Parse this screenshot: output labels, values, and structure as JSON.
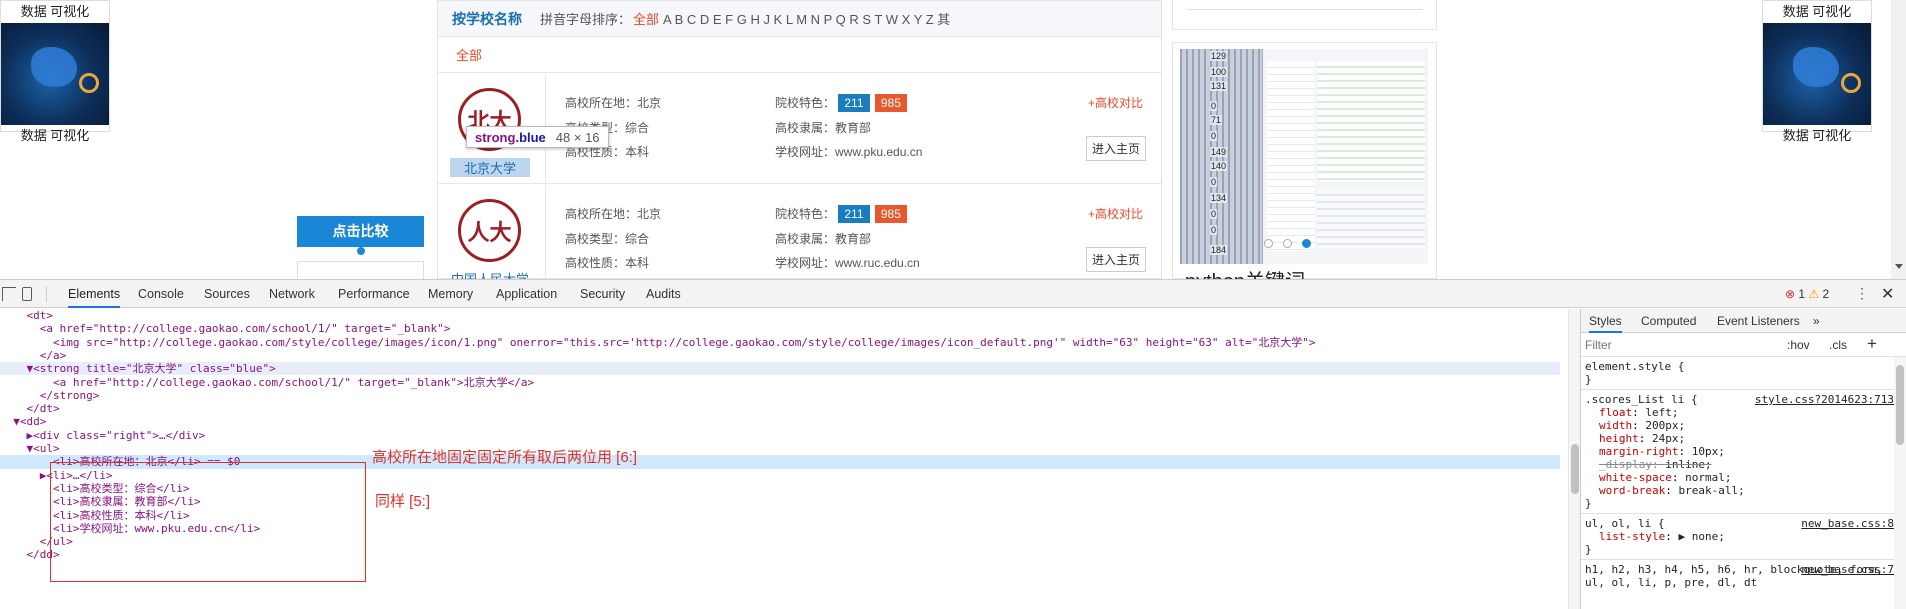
{
  "page": {
    "ads": [
      {
        "caption_top": "数据 可视化",
        "caption_bottom": "数据 可视化"
      },
      {
        "caption_top": "数据 可视化",
        "caption_bottom": "数据 可视化"
      }
    ],
    "sortbar": {
      "title": "按学校名称",
      "pinyin_label": "拼音字母排序：",
      "all": "全部",
      "letters": "A B C D E F G H J K L M N P Q R S T W X Y Z 其"
    },
    "all_row": "全部",
    "colleges": [
      {
        "logo": "北大",
        "name": "北京大学",
        "location": "高校所在地：北京",
        "type": "高校类型：综合",
        "nature": "高校性质：本科",
        "feature_label": "院校特色：",
        "tag1": "211",
        "tag2": "985",
        "affiliation": "高校隶属：教育部",
        "site": "学校网址：www.pku.edu.cn",
        "compare": "+高校对比",
        "home": "进入主页"
      },
      {
        "logo": "人大",
        "name": "中国人民大学",
        "location": "高校所在地：北京",
        "type": "高校类型：综合",
        "nature": "高校性质：本科",
        "feature_label": "院校特色：",
        "tag1": "211",
        "tag2": "985",
        "affiliation": "高校隶属：教育部",
        "site": "学校网址：www.ruc.edu.cn",
        "compare": "+高校对比",
        "home": "进入主页"
      }
    ],
    "tooltip": {
      "tag": "strong",
      "cls": ".blue",
      "size": "48 × 16"
    },
    "compare_button": "点击比较",
    "side_ruler": [
      "129",
      "100",
      "131",
      "0",
      "71",
      "0",
      "149",
      "140",
      "0",
      "134",
      "0",
      "0",
      "184"
    ],
    "side_keyword": "python关键词"
  },
  "devtools": {
    "tabs": [
      "Elements",
      "Console",
      "Sources",
      "Network",
      "Performance",
      "Memory",
      "Application",
      "Security",
      "Audits"
    ],
    "active_tab": "Elements",
    "errors": "1",
    "warnings": "2",
    "dom_lines": [
      {
        "t": "    <dt>"
      },
      {
        "t": "      <a href=\"http://college.gaokao.com/school/1/\" target=\"_blank\">"
      },
      {
        "t": "        <img src=\"http://college.gaokao.com/style/college/images/icon/1.png\" onerror=\"this.src='http://college.gaokao.com/style/college/images/icon_default.png'\" width=\"63\" height=\"63\" alt=\"北京大学\">"
      },
      {
        "t": "      </a>"
      },
      {
        "t": "    ▼<strong title=\"北京大学\" class=\"blue\">"
      },
      {
        "t": "        <a href=\"http://college.gaokao.com/school/1/\" target=\"_blank\">北京大学</a>"
      },
      {
        "t": "      </strong>"
      },
      {
        "t": "    </dt>"
      },
      {
        "t": "  ▼<dd>"
      },
      {
        "t": "    ▶<div class=\"right\">…</div>"
      },
      {
        "t": "    ▼<ul>"
      },
      {
        "t": "        <li>高校所在地：北京</li> == $0"
      },
      {
        "t": "      ▶<li>…</li>"
      },
      {
        "t": "        <li>高校类型：综合</li>"
      },
      {
        "t": "        <li>高校隶属：教育部</li>"
      },
      {
        "t": "        <li>高校性质：本科</li>"
      },
      {
        "t": "        <li>学校网址：www.pku.edu.cn</li>"
      },
      {
        "t": "      </ul>"
      },
      {
        "t": "    </dd>"
      }
    ],
    "annotation_1": "高校所在地固定固定所有取后两位用 [6:]",
    "annotation_2": "同样 [5:]",
    "styles_tabs": [
      "Styles",
      "Computed",
      "Event Listeners"
    ],
    "filter_placeholder": "Filter",
    "hov": ":hov",
    "cls": ".cls",
    "rules": [
      {
        "selector": "element.style {",
        "source": "",
        "props": [],
        "close": "}"
      },
      {
        "selector": ".scores_List li {",
        "source": "style.css?2014623:713",
        "props": [
          {
            "n": "float",
            "v": "left;",
            "struck": false
          },
          {
            "n": "width",
            "v": "200px;",
            "struck": false
          },
          {
            "n": "height",
            "v": "24px;",
            "struck": false
          },
          {
            "n": "margin-right",
            "v": "10px;",
            "struck": false
          },
          {
            "n": "_display",
            "v": "inline;",
            "struck": true
          },
          {
            "n": "white-space",
            "v": "normal;",
            "struck": false
          },
          {
            "n": "word-break",
            "v": "break-all;",
            "struck": false
          }
        ],
        "close": "}"
      },
      {
        "selector": "ul, ol, li {",
        "source": "new_base.css:8",
        "props": [
          {
            "n": "list-style",
            "v": "▶ none;",
            "struck": false
          }
        ],
        "close": "}"
      },
      {
        "selector": "h1, h2, h3, h4, h5, h6, hr, blockquote, form, ul, ol, li, p, pre, dl, dt",
        "source": "new_base.css:7",
        "props": [],
        "close": ""
      }
    ]
  },
  "colors": {
    "accent": "#1a73e8",
    "brand_blue": "#1a6fb3",
    "red": "#e54b2a",
    "annotation": "#e0302a"
  }
}
